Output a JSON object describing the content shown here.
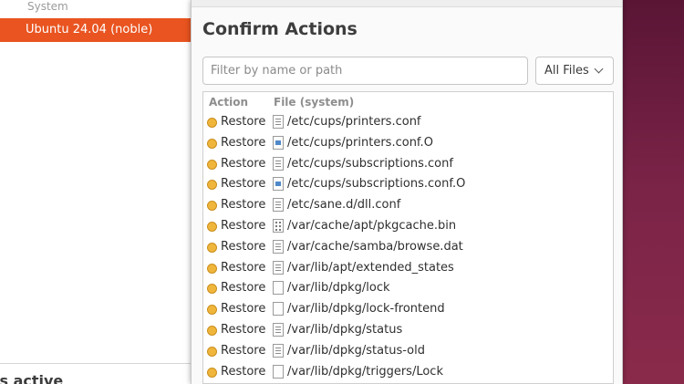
{
  "background_window": {
    "section_label": "System",
    "selected_item": "Ubuntu 24.04 (noble)",
    "bottom_text": "is active"
  },
  "dialog": {
    "title": "Confirm Actions",
    "filter_placeholder": "Filter by name or path",
    "filter_value": "",
    "filter_dropdown": "All Files",
    "columns": {
      "action": "Action",
      "file": "File (system)"
    },
    "rows": [
      {
        "action": "Restore",
        "path": "/etc/cups/printers.conf",
        "icon": "text-file-icon"
      },
      {
        "action": "Restore",
        "path": "/etc/cups/printers.conf.O",
        "icon": "image-file-icon"
      },
      {
        "action": "Restore",
        "path": "/etc/cups/subscriptions.conf",
        "icon": "text-file-icon"
      },
      {
        "action": "Restore",
        "path": "/etc/cups/subscriptions.conf.O",
        "icon": "image-file-icon"
      },
      {
        "action": "Restore",
        "path": "/etc/sane.d/dll.conf",
        "icon": "text-file-icon"
      },
      {
        "action": "Restore",
        "path": "/var/cache/apt/pkgcache.bin",
        "icon": "binary-file-icon"
      },
      {
        "action": "Restore",
        "path": "/var/cache/samba/browse.dat",
        "icon": "text-file-icon"
      },
      {
        "action": "Restore",
        "path": "/var/lib/apt/extended_states",
        "icon": "text-file-icon"
      },
      {
        "action": "Restore",
        "path": "/var/lib/dpkg/lock",
        "icon": "empty-file-icon"
      },
      {
        "action": "Restore",
        "path": "/var/lib/dpkg/lock-frontend",
        "icon": "empty-file-icon"
      },
      {
        "action": "Restore",
        "path": "/var/lib/dpkg/status",
        "icon": "text-file-icon"
      },
      {
        "action": "Restore",
        "path": "/var/lib/dpkg/status-old",
        "icon": "text-file-icon"
      },
      {
        "action": "Restore",
        "path": "/var/lib/dpkg/triggers/Lock",
        "icon": "empty-file-icon"
      }
    ]
  },
  "colors": {
    "accent": "#e95420",
    "status_dot": "#f0b63b",
    "desktop": "#6e1f3c"
  }
}
